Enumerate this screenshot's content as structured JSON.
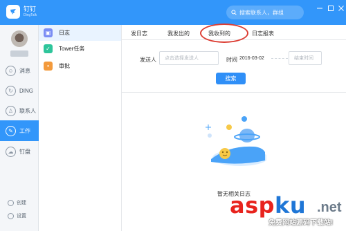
{
  "app": {
    "name": "钉钉",
    "sub": "DingTalk"
  },
  "search": {
    "placeholder": "搜索联系人，群组"
  },
  "leftnav": {
    "items": [
      {
        "label": "消息",
        "icon": "message-icon"
      },
      {
        "label": "DING",
        "icon": "ding-icon"
      },
      {
        "label": "联系人",
        "icon": "contacts-icon"
      },
      {
        "label": "工作",
        "icon": "work-icon",
        "active": true
      },
      {
        "label": "钉盘",
        "icon": "cloud-disk-icon"
      }
    ],
    "create": "创建",
    "settings": "设置"
  },
  "subnav": {
    "items": [
      {
        "label": "日志",
        "icon": "log-icon",
        "color": "#7b8df4",
        "active": true
      },
      {
        "label": "Tower任务",
        "icon": "check-icon",
        "color": "#2ec59b"
      },
      {
        "label": "审批",
        "icon": "approval-icon",
        "color": "#f39a3c"
      }
    ]
  },
  "main": {
    "tabs": [
      "发日志",
      "我发出的",
      "我收到的",
      "日志报表"
    ],
    "active_tab": "我收到的",
    "filter": {
      "sender_label": "发送人",
      "sender_placeholder": "点击选择发送人",
      "time_label": "时间",
      "start_date": "2016-03-02",
      "end_placeholder": "结束时间",
      "search_button": "搜索"
    },
    "empty_text": "暂无相关日志"
  },
  "watermark": {
    "brand_a": "asp",
    "brand_b": "ku",
    "brand_c": ".net",
    "sub": "免费网站源码下载站!"
  },
  "colors": {
    "accent": "#3296fa",
    "highlight": "#dc3d33"
  }
}
